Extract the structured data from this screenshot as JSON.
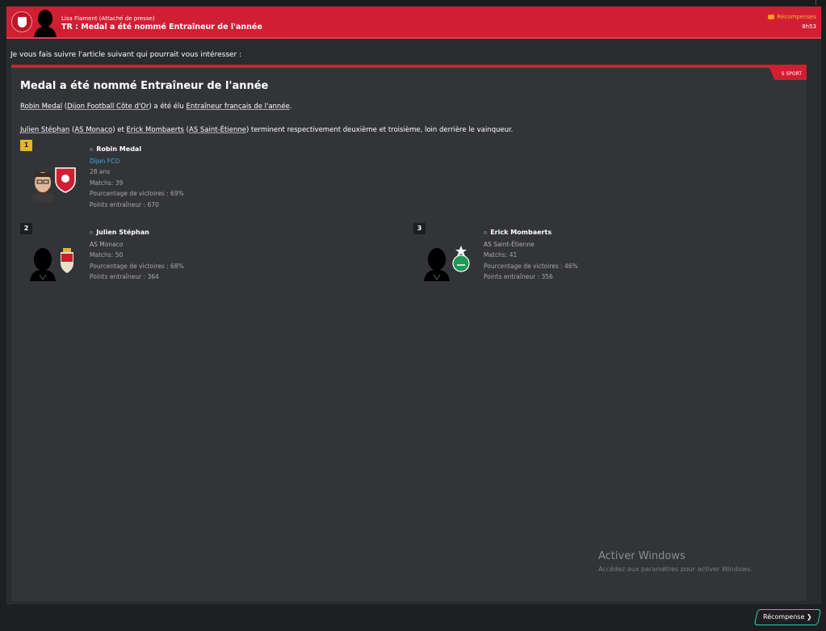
{
  "message": {
    "sender": "Lisa Flament  (Attaché de presse)",
    "subject": "TR : Medal a été nommé Entraîneur de l'année",
    "reward_tag": "Récompenses",
    "time": "8h53",
    "intro": "Je vous fais suivre l'article suivant qui pourrait vous intéresser :"
  },
  "article": {
    "source": "S SPORT",
    "title": "Medal a été nommé Entraîneur de l'année",
    "p1": {
      "link_person": "Robin Medal",
      "link_club": "Dijon Football Côte d'Or",
      "mid": " a été élu ",
      "link_award": "Entraîneur français de l'année",
      "end": "."
    },
    "p2": {
      "link1": "Julien Stéphan",
      "link2": "AS Monaco",
      "link3": "Erick Mombaerts",
      "link4": "AS Saint-Étienne",
      "rest": " terminent respectivement deuxième et troisième, loin derrière le vainqueur."
    }
  },
  "ranking": [
    {
      "rank": "1",
      "name": "Robin Medal",
      "club": "Dijon FCO",
      "age": "28 ans",
      "matches": "Matchs: 39",
      "win_pct": "Pourcentage de victoires : 69%",
      "points": "Points entraîneur : 670"
    },
    {
      "rank": "2",
      "name": "Julien Stéphan",
      "club": "AS Monaco",
      "matches": "Matchs: 50",
      "win_pct": "Pourcentage de victoires : 68%",
      "points": "Points entraîneur : 364"
    },
    {
      "rank": "3",
      "name": "Erick Mombaerts",
      "club": "AS Saint-Étienne",
      "matches": "Matchs: 41",
      "win_pct": "Pourcentage de victoires : 46%",
      "points": "Points entraîneur : 356"
    }
  ],
  "watermark": {
    "title": "Activer Windows",
    "subtitle": "Accédez aux paramètres pour activer Windows."
  },
  "footer": {
    "reward_button": "Récompense ❯"
  },
  "colors": {
    "accent_red": "#d01f32",
    "gold": "#e2b721",
    "link_blue": "#3bb5e8",
    "button_teal": "#2ad1b0"
  }
}
